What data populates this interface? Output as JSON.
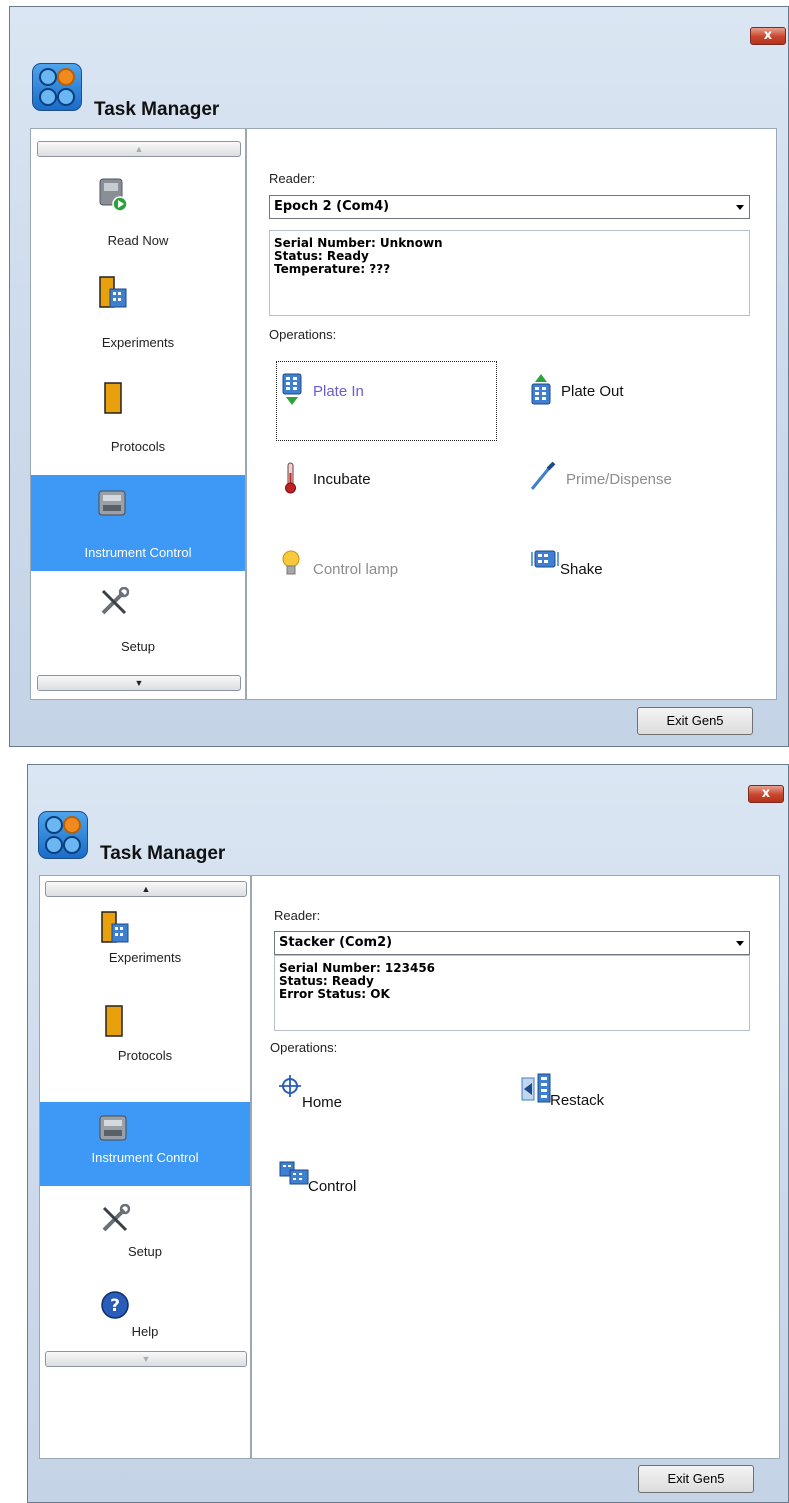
{
  "windows": [
    {
      "title": "Task Manager",
      "close_glyph": "x",
      "sidebar": {
        "scroll_up": "▲",
        "scroll_down": "▼",
        "items": [
          {
            "label": "Read Now",
            "icon": "read-now-icon"
          },
          {
            "label": "Experiments",
            "icon": "experiments-icon"
          },
          {
            "label": "Protocols",
            "icon": "protocols-icon"
          },
          {
            "label": "Instrument Control",
            "icon": "instrument-control-icon",
            "selected": true
          },
          {
            "label": "Setup",
            "icon": "setup-icon"
          }
        ]
      },
      "reader_label": "Reader:",
      "reader_value": "Epoch 2 (Com4)",
      "info_lines": [
        "Serial Number: Unknown",
        "Status: Ready",
        "Temperature: ???"
      ],
      "operations_label": "Operations:",
      "operations": [
        {
          "label": "Plate In",
          "icon": "plate-in-icon",
          "state": "focused"
        },
        {
          "label": "Plate Out",
          "icon": "plate-out-icon",
          "state": "enabled"
        },
        {
          "label": "Incubate",
          "icon": "thermometer-icon",
          "state": "enabled"
        },
        {
          "label": "Prime/Dispense",
          "icon": "dispense-icon",
          "state": "disabled"
        },
        {
          "label": "Control lamp",
          "icon": "lamp-icon",
          "state": "disabled"
        },
        {
          "label": "Shake",
          "icon": "shake-icon",
          "state": "enabled"
        }
      ],
      "exit_label": "Exit Gen5"
    },
    {
      "title": "Task Manager",
      "close_glyph": "x",
      "sidebar": {
        "scroll_up": "▲",
        "scroll_down": "▼",
        "items": [
          {
            "label": "Experiments",
            "icon": "experiments-icon"
          },
          {
            "label": "Protocols",
            "icon": "protocols-icon"
          },
          {
            "label": "Instrument Control",
            "icon": "instrument-control-icon",
            "selected": true
          },
          {
            "label": "Setup",
            "icon": "setup-icon"
          },
          {
            "label": "Help",
            "icon": "help-icon",
            "glyph": "?"
          }
        ]
      },
      "reader_label": "Reader:",
      "reader_value": "Stacker (Com2)",
      "info_lines": [
        "Serial Number: 123456",
        "Status: Ready",
        "Error Status: OK"
      ],
      "operations_label": "Operations:",
      "operations": [
        {
          "label": "Home",
          "icon": "home-crosshair-icon",
          "state": "enabled"
        },
        {
          "label": "Restack",
          "icon": "restack-icon",
          "state": "enabled"
        },
        {
          "label": "Control",
          "icon": "stacker-control-icon",
          "state": "enabled"
        }
      ],
      "exit_label": "Exit Gen5"
    }
  ],
  "colors": {
    "selection": "#3d99f5",
    "disabled_text": "#8d8d8d",
    "focused_text": "#6a5bd6",
    "close_button": "#c9442c"
  }
}
